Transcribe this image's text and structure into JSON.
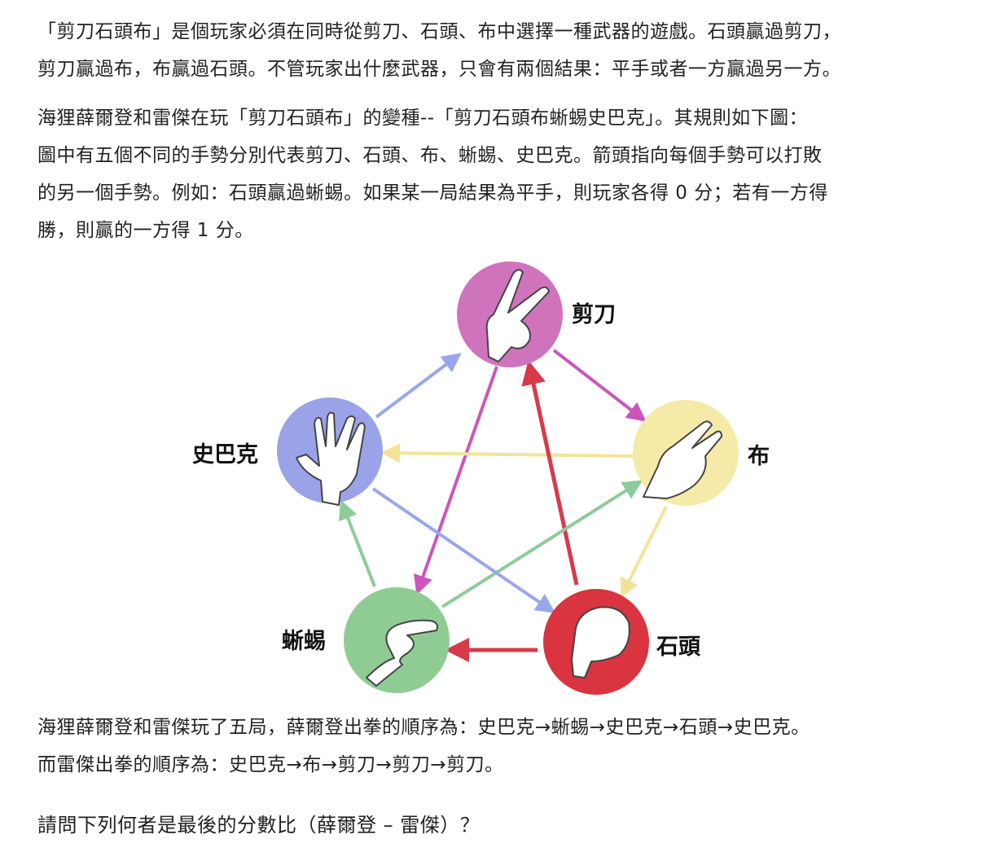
{
  "intro": {
    "line1": "「剪刀石頭布」是個玩家必須在同時從剪刀、石頭、布中選擇一種武器的遊戲。石頭贏過剪刀，",
    "line2": "剪刀贏過布，布贏過石頭。不管玩家出什麼武器，只會有兩個結果：平手或者一方贏過另一方。"
  },
  "rules": {
    "line1": "海狸薛爾登和雷傑在玩「剪刀石頭布」的變種--「剪刀石頭布蜥蜴史巴克」。其規則如下圖：",
    "line2": "圖中有五個不同的手勢分別代表剪刀、石頭、布、蜥蜴、史巴克。箭頭指向每個手勢可以打敗",
    "line3": "的另一個手勢。例如：石頭贏過蜥蜴。如果某一局結果為平手，則玩家各得 0 分；若有一方得",
    "line4": "勝，則贏的一方得 1 分。"
  },
  "diagram": {
    "labels": {
      "scissors": "剪刀",
      "paper": "布",
      "rock": "石頭",
      "lizard": "蜥蜴",
      "spock": "史巴克"
    },
    "colors": {
      "scissors": "#cf73bd",
      "paper": "#f6eaa8",
      "rock": "#d9343f",
      "lizard": "#8fcc94",
      "spock": "#9aa3e8",
      "arrow_scissors": "#cc55bb",
      "arrow_paper": "#f3e39a",
      "arrow_rock": "#d83a4a",
      "arrow_lizard": "#8ecb9a",
      "arrow_spock": "#9aa6ea"
    }
  },
  "games": {
    "line1": "海狸薛爾登和雷傑玩了五局，薛爾登出拳的順序為：史巴克→蜥蜴→史巴克→石頭→史巴克。",
    "line2": "而雷傑出拳的順序為：史巴克→布→剪刀→剪刀→剪刀。"
  },
  "question": "請問下列何者是最後的分數比（薛爾登 – 雷傑）？"
}
